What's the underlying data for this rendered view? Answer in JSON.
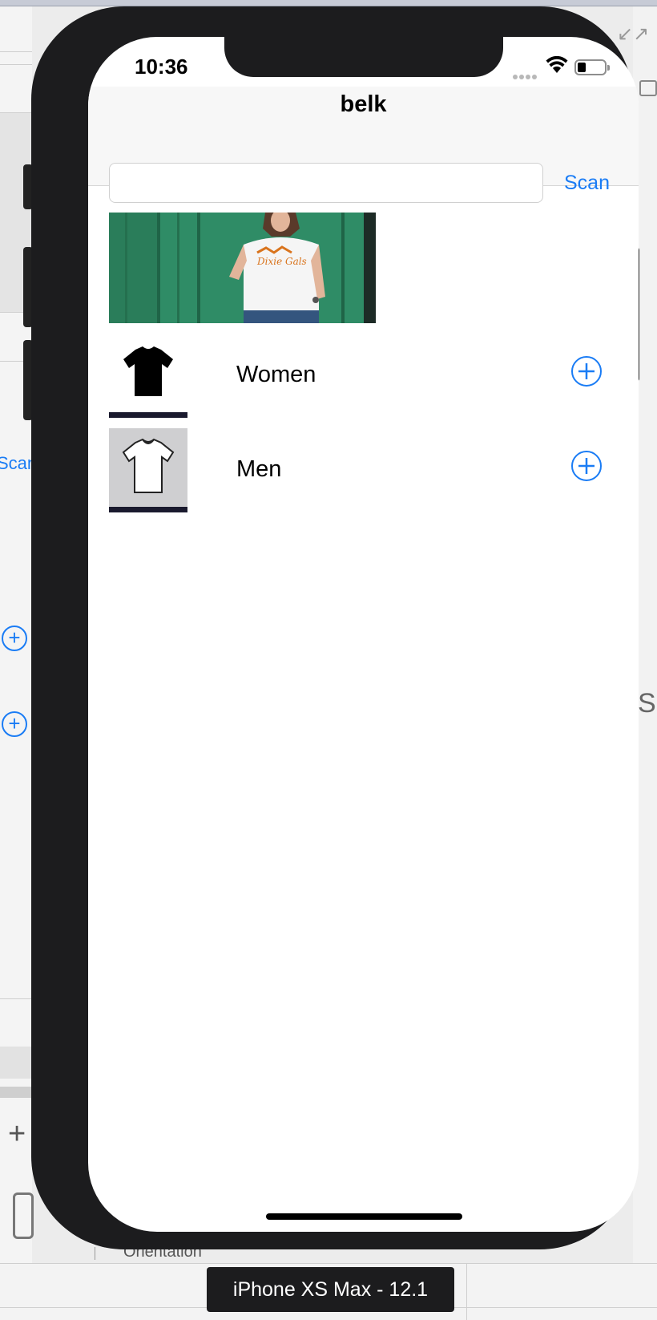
{
  "status_bar": {
    "time": "10:36"
  },
  "navbar": {
    "title": "belk"
  },
  "search": {
    "value": "",
    "placeholder": "",
    "scan_label": "Scan"
  },
  "categories": [
    {
      "label": "Women"
    },
    {
      "label": "Men"
    }
  ],
  "background": {
    "scan_label_partial": "Scan",
    "orientation_label": "Orientation",
    "right_partial": "S",
    "arrows": "↙↗"
  },
  "simulator": {
    "device_label": "iPhone XS Max - 12.1"
  },
  "colors": {
    "accent": "#1a7cf5",
    "device": "#1c1c1e",
    "navbar": "#f7f7f7"
  }
}
